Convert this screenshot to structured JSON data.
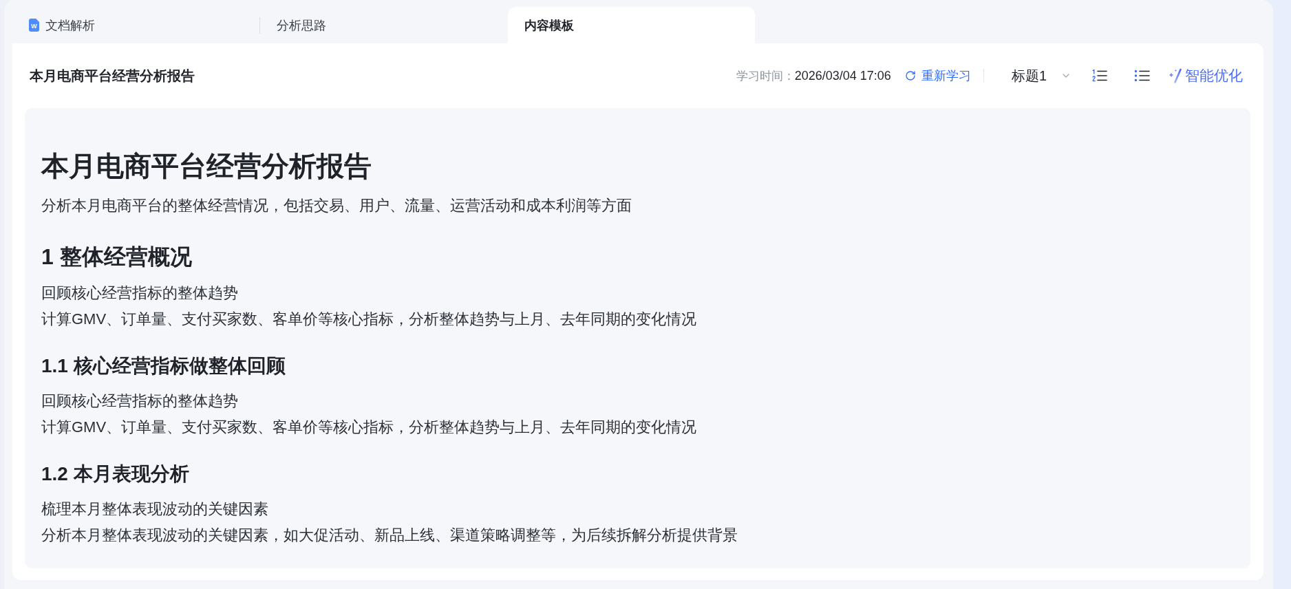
{
  "tabs": [
    {
      "label": "文档解析",
      "file_icon_letter": "W",
      "selected": false
    },
    {
      "label": "分析思路",
      "selected": false
    },
    {
      "label": "内容模板",
      "selected": true
    }
  ],
  "header": {
    "title": "本月电商平台经营分析报告",
    "learn_time_label": "学习时间：",
    "learn_time": "2026/03/04 17:06",
    "relearn_button": "重新学习",
    "heading_style": "标题1",
    "smart_optimize_button": "智能优化"
  },
  "document": {
    "title": "本月电商平台经营分析报告",
    "summary": "分析本月电商平台的整体经营情况，包括交易、用户、流量、运营活动和成本利润等方面",
    "sections": [
      {
        "heading": "1 整体经营概况",
        "paragraphs": [
          "回顾核心经营指标的整体趋势",
          "计算GMV、订单量、支付买家数、客单价等核心指标，分析整体趋势与上月、去年同期的变化情况"
        ],
        "children": [
          {
            "heading": "1.1 核心经营指标做整体回顾",
            "paragraphs": [
              "回顾核心经营指标的整体趋势",
              "计算GMV、订单量、支付买家数、客单价等核心指标，分析整体趋势与上月、去年同期的变化情况"
            ]
          },
          {
            "heading": "1.2 本月表现分析",
            "paragraphs": [
              "梳理本月整体表现波动的关键因素",
              "分析本月整体表现波动的关键因素，如大促活动、新品上线、渠道策略调整等，为后续拆解分析提供背景"
            ]
          }
        ]
      }
    ]
  }
}
